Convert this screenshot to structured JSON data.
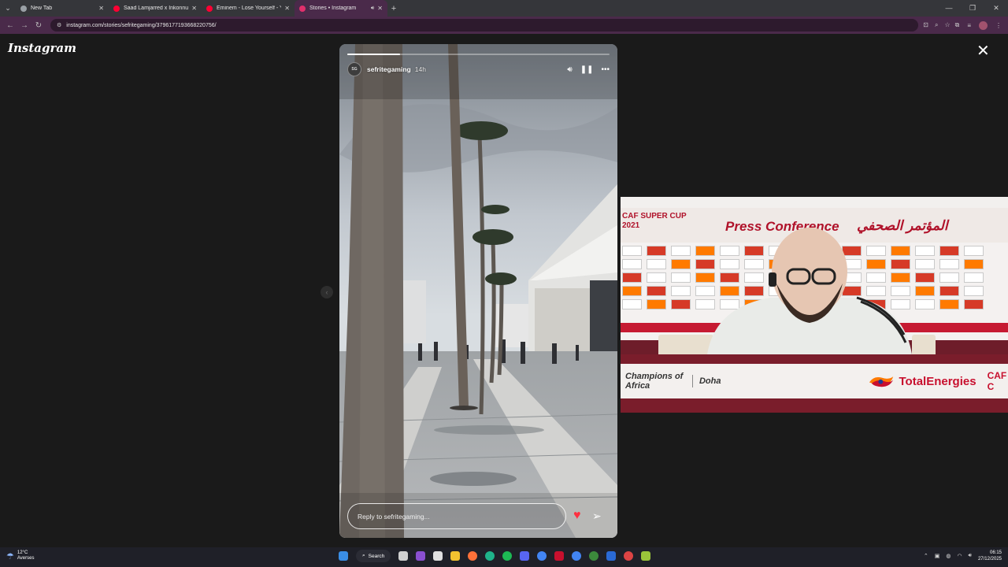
{
  "browser": {
    "tabs": [
      {
        "title": "New Tab",
        "favicon_color": "#9aa0a6",
        "active": false
      },
      {
        "title": "Saad Lamjarred x Inkonnu x Ati",
        "favicon_color": "#ff0033",
        "active": false
      },
      {
        "title": "Eminem - Lose Yourself - YouT",
        "favicon_color": "#ff0033",
        "active": false
      },
      {
        "title": "Stories • Instagram",
        "favicon_color": "#e1306c",
        "active": true
      }
    ],
    "url": "instagram.com/stories/sefritegaming/3796177193668220756/"
  },
  "page": {
    "logo": "Instagram",
    "close_label": "✕"
  },
  "story": {
    "username": "sefritegaming",
    "time": "14h",
    "progress": 0.2,
    "reply_placeholder": "Reply to sefritegaming..."
  },
  "pip": {
    "event_line1": "CAF SUPER CUP",
    "event_line2": "2021",
    "title_en": "Press Conference",
    "title_ar": "المؤتمر الصحفي",
    "sign_left": "Champions of Africa",
    "sign_city": "Doha",
    "sign_brand": "TotalEnergies",
    "sign_right": "CAF C"
  },
  "taskbar": {
    "weather_temp": "12°C",
    "weather_desc": "Averses",
    "search_label": "Search",
    "time": "06:15",
    "date": "27/12/2025"
  }
}
